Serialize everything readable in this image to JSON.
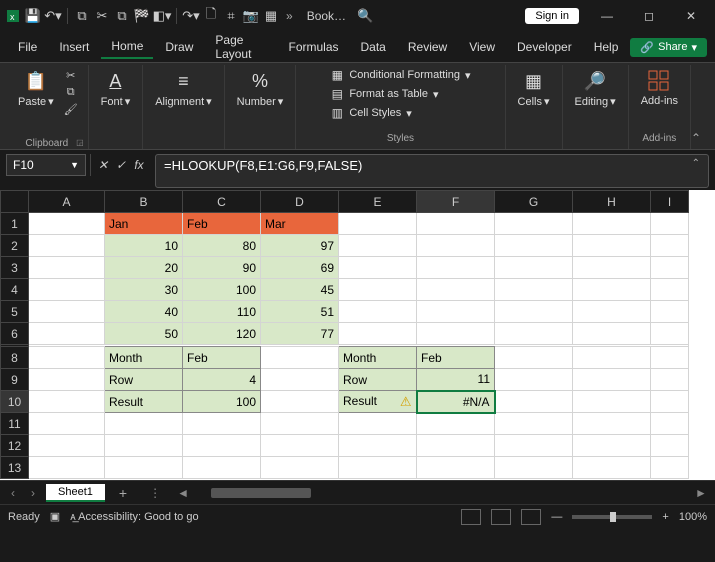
{
  "title": "Book…",
  "signin": "Sign in",
  "menu": {
    "file": "File",
    "insert": "Insert",
    "home": "Home",
    "draw": "Draw",
    "pagelayout": "Page Layout",
    "formulas": "Formulas",
    "data": "Data",
    "review": "Review",
    "view": "View",
    "developer": "Developer",
    "help": "Help",
    "share": "Share"
  },
  "ribbon": {
    "clipboard": "Clipboard",
    "paste": "Paste",
    "font": "Font",
    "alignment": "Alignment",
    "number": "Number",
    "styles": "Styles",
    "cond": "Conditional Formatting",
    "fmt": "Format as Table",
    "cellstyles": "Cell Styles",
    "cells": "Cells",
    "editing": "Editing",
    "addins": "Add-ins"
  },
  "namebox": "F10",
  "formula": "=HLOOKUP(F8,E1:G6,F9,FALSE)",
  "cols": [
    "A",
    "B",
    "C",
    "D",
    "E",
    "F",
    "G",
    "H",
    "I"
  ],
  "rows": [
    "1",
    "2",
    "3",
    "4",
    "5",
    "6",
    "8",
    "9",
    "10",
    "11",
    "12",
    "13"
  ],
  "cells": {
    "B1": "Jan",
    "C1": "Feb",
    "D1": "Mar",
    "B2": "10",
    "C2": "80",
    "D2": "97",
    "B3": "20",
    "C3": "90",
    "D3": "69",
    "B4": "30",
    "C4": "100",
    "D4": "45",
    "B5": "40",
    "C5": "110",
    "D5": "51",
    "B6": "50",
    "C6": "120",
    "D6": "77",
    "B8": "Month",
    "C8": "Feb",
    "E8": "Month",
    "F8": "Feb",
    "B9": "Row",
    "C9": "4",
    "E9": "Row",
    "F9": "11",
    "B10": "Result",
    "C10": "100",
    "E10": "Result",
    "F10": "#N/A"
  },
  "sheet": "Sheet1",
  "status": {
    "ready": "Ready",
    "access": "Accessibility: Good to go",
    "zoom": "100%"
  },
  "chart_data": {
    "type": "table",
    "note": "Spreadsheet demonstrating HLOOKUP",
    "source_table": {
      "columns": [
        "Jan",
        "Feb",
        "Mar"
      ],
      "rows": [
        [
          10,
          80,
          97
        ],
        [
          20,
          90,
          69
        ],
        [
          30,
          100,
          45
        ],
        [
          40,
          110,
          51
        ],
        [
          50,
          120,
          77
        ]
      ]
    },
    "lookup_left": {
      "Month": "Feb",
      "Row": 4,
      "Result": 100
    },
    "lookup_right": {
      "Month": "Feb",
      "Row": 11,
      "Result": "#N/A"
    },
    "active_cell_formula": "=HLOOKUP(F8,E1:G6,F9,FALSE)"
  }
}
